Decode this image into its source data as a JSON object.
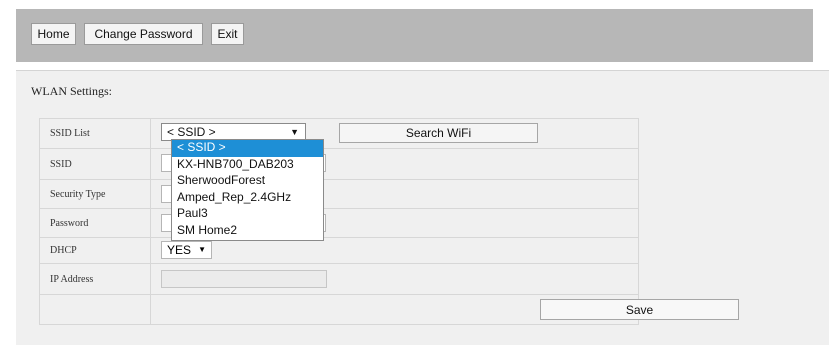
{
  "nav": {
    "home": "Home",
    "change_password": "Change Password",
    "exit": "Exit"
  },
  "section_title": "WLAN Settings:",
  "form": {
    "ssid_list": {
      "label": "SSID List",
      "selected": "< SSID >"
    },
    "search_wifi_label": "Search WiFi",
    "ssid": {
      "label": "SSID",
      "value": ""
    },
    "security_type": {
      "label": "Security Type",
      "value": ""
    },
    "password": {
      "label": "Password",
      "value": ""
    },
    "dhcp": {
      "label": "DHCP",
      "selected": "YES"
    },
    "ip_address": {
      "label": "IP Address",
      "value": ""
    },
    "save_label": "Save"
  },
  "ssid_dropdown": {
    "options": [
      "< SSID >",
      "KX-HNB700_DAB203",
      "SherwoodForest",
      "Amped_Rep_2.4GHz",
      "Paul3",
      "SM Home2"
    ],
    "highlighted_index": 0
  },
  "colors": {
    "topbar": "#b7b7b7",
    "panel": "#f0f0f0",
    "highlight": "#1e8fd6"
  }
}
